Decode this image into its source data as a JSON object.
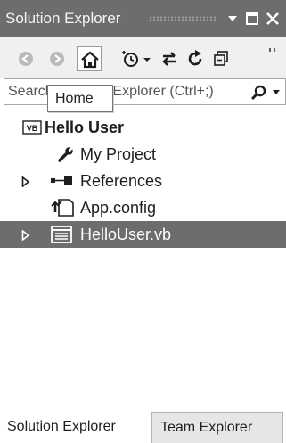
{
  "window": {
    "title": "Solution Explorer",
    "dropdown_icon": "chevron-down-icon",
    "maximize_icon": "maximize-icon",
    "close_icon": "close-icon"
  },
  "toolbar": {
    "back_icon": "back-icon",
    "forward_icon": "forward-icon",
    "home_icon": "home-icon",
    "pending_changes_icon": "clock-icon",
    "sync_icon": "sync-icon",
    "refresh_icon": "refresh-icon",
    "collapse_icon": "collapse-all-icon"
  },
  "search": {
    "placeholder": "Search Solution Explorer (Ctrl+;)",
    "icon": "search-icon"
  },
  "tooltip": {
    "text": "Home"
  },
  "tree": {
    "items": [
      {
        "label": "Hello User",
        "icon": "vb-project-icon",
        "bold": true,
        "expander": "none"
      },
      {
        "label": "My Project",
        "icon": "wrench-icon",
        "expander": "none"
      },
      {
        "label": "References",
        "icon": "references-icon",
        "expander": "collapsed"
      },
      {
        "label": "App.config",
        "icon": "config-file-icon",
        "expander": "none"
      },
      {
        "label": "HelloUser.vb",
        "icon": "vb-form-icon",
        "expander": "collapsed",
        "selected": true
      }
    ]
  },
  "tabs": [
    {
      "label": "Solution Explorer",
      "active": true
    },
    {
      "label": "Team Explorer",
      "active": false
    }
  ],
  "colors": {
    "titlebar": "#6d6d6d",
    "selection": "#6d6d6d",
    "toolbar": "#f0f0f0"
  }
}
